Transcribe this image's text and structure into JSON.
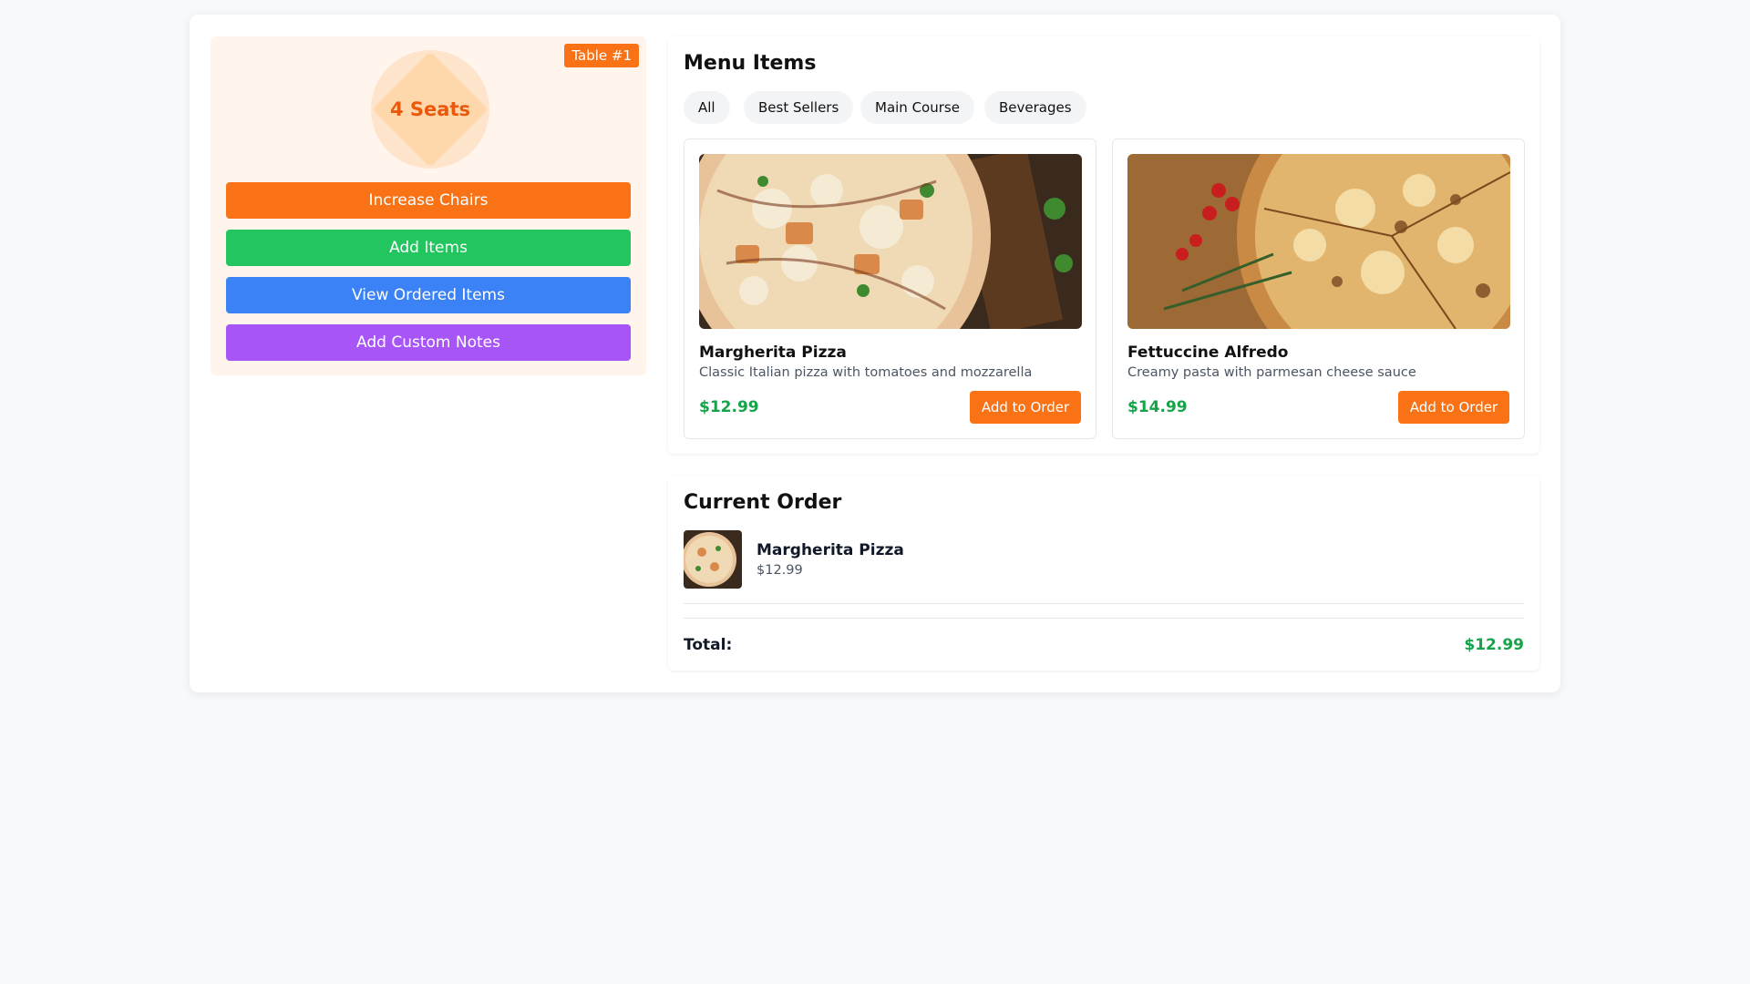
{
  "table": {
    "badge": "Table #1",
    "seats": "4 Seats",
    "actions": [
      {
        "label": "Increase Chairs"
      },
      {
        "label": "Add Items"
      },
      {
        "label": "View Ordered Items"
      },
      {
        "label": "Add Custom Notes"
      }
    ]
  },
  "menu": {
    "title": "Menu Items",
    "filters": [
      "All",
      "Best Sellers",
      "Main Course",
      "Beverages"
    ],
    "items": [
      {
        "name": "Margherita Pizza",
        "description": "Classic Italian pizza with tomatoes and mozzarella",
        "price": "$12.99",
        "button": "Add to Order",
        "image": "pizza-photo"
      },
      {
        "name": "Fettuccine Alfredo",
        "description": "Creamy pasta with parmesan cheese sauce",
        "price": "$14.99",
        "button": "Add to Order",
        "image": "pizza-photo"
      }
    ]
  },
  "order": {
    "title": "Current Order",
    "items": [
      {
        "name": "Margherita Pizza",
        "price": "$12.99",
        "image": "pizza-thumbnail"
      }
    ],
    "total_label": "Total:",
    "total_value": "$12.99"
  },
  "colors": {
    "accent": "#f97316",
    "green": "#22c55e",
    "blue": "#3b82f6",
    "purple": "#a855f7",
    "price": "#16a34a"
  }
}
